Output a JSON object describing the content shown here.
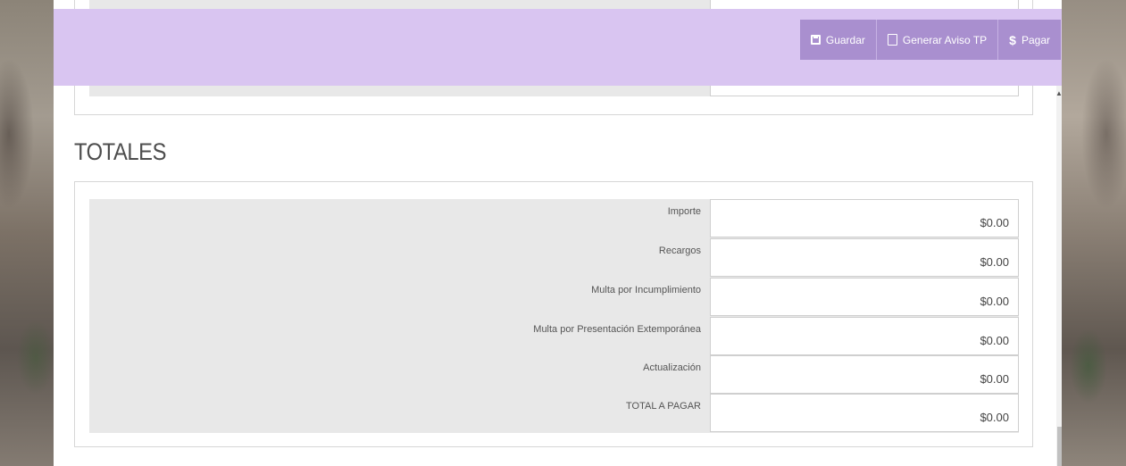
{
  "toolbar": {
    "save_label": "Guardar",
    "notice_label": "Generar Aviso TP",
    "pay_label": "Pagar",
    "pay_symbol": "$"
  },
  "totals": {
    "title": "TOTALES",
    "rows": [
      {
        "label": "Importe",
        "value": "$0.00"
      },
      {
        "label": "Recargos",
        "value": "$0.00"
      },
      {
        "label": "Multa por Incumplimiento",
        "value": "$0.00"
      },
      {
        "label": "Multa por Presentación Extemporánea",
        "value": "$0.00"
      },
      {
        "label": "Actualización",
        "value": "$0.00"
      },
      {
        "label": "TOTAL A PAGAR",
        "value": "$0.00"
      }
    ]
  },
  "colors": {
    "topbar": "#d9c5f1",
    "button": "#a98fcf",
    "panel_gray": "#e8e8e8"
  }
}
